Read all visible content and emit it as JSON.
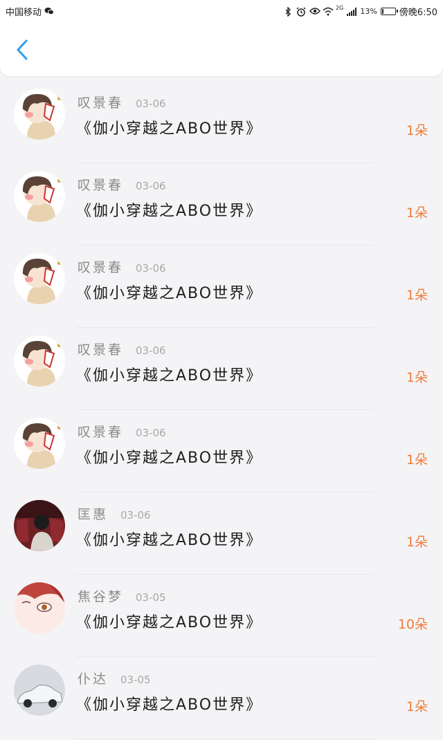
{
  "status_bar": {
    "carrier": "中国移动",
    "network": "2G",
    "battery": "13%",
    "battery_level": 0.13,
    "time": "傍晚6:50"
  },
  "header": {
    "back_icon": "chevron-left-icon",
    "accent_color": "#2e9cf0"
  },
  "colors": {
    "count": "#f07c3c",
    "name": "#8a8a8a",
    "title": "#1e1e1e"
  },
  "rows": [
    {
      "name": "叹景春",
      "date": "03-06",
      "title": "《伽小穿越之ABO世界》",
      "count": "1朵",
      "avatar": "chibi-boy"
    },
    {
      "name": "叹景春",
      "date": "03-06",
      "title": "《伽小穿越之ABO世界》",
      "count": "1朵",
      "avatar": "chibi-boy"
    },
    {
      "name": "叹景春",
      "date": "03-06",
      "title": "《伽小穿越之ABO世界》",
      "count": "1朵",
      "avatar": "chibi-boy"
    },
    {
      "name": "叹景春",
      "date": "03-06",
      "title": "《伽小穿越之ABO世界》",
      "count": "1朵",
      "avatar": "chibi-boy"
    },
    {
      "name": "叹景春",
      "date": "03-06",
      "title": "《伽小穿越之ABO世界》",
      "count": "1朵",
      "avatar": "chibi-boy"
    },
    {
      "name": "匡惠",
      "date": "03-06",
      "title": "《伽小穿越之ABO世界》",
      "count": "1朵",
      "avatar": "photo-person"
    },
    {
      "name": "焦谷梦",
      "date": "03-05",
      "title": "《伽小穿越之ABO世界》",
      "count": "10朵",
      "avatar": "anime-eye"
    },
    {
      "name": "仆达",
      "date": "03-05",
      "title": "《伽小穿越之ABO世界》",
      "count": "1朵",
      "avatar": "car"
    }
  ]
}
